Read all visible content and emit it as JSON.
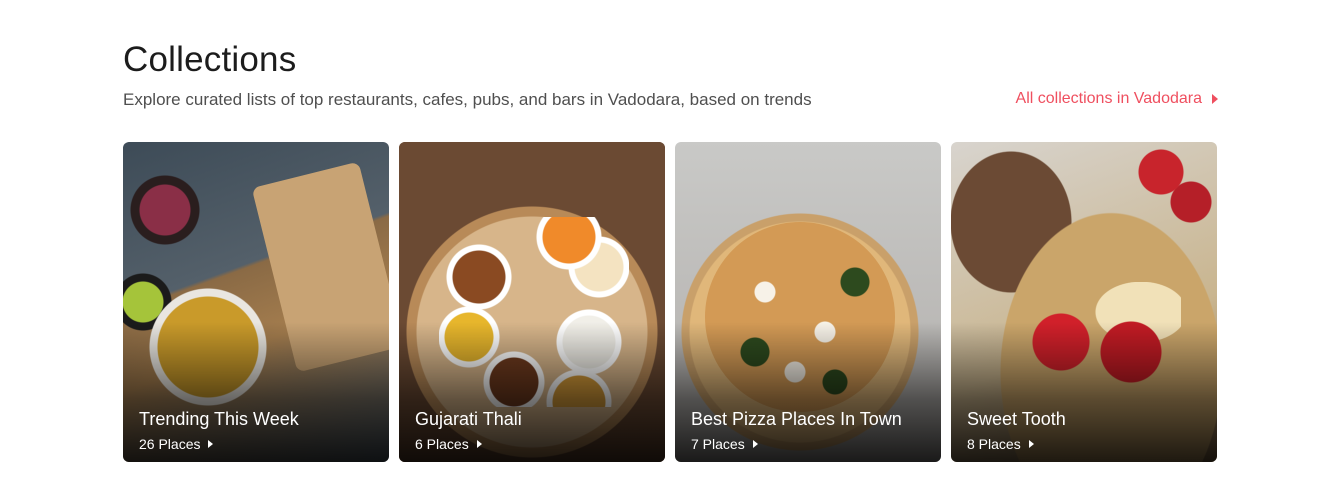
{
  "header": {
    "title": "Collections",
    "subtitle": "Explore curated lists of top restaurants, cafes, pubs, and bars in Vadodara, based on trends",
    "all_link": "All collections in Vadodara"
  },
  "colors": {
    "accent": "#ef4f5f",
    "title": "#1c1c1c",
    "subtitle": "#4f4f4f"
  },
  "collections": [
    {
      "name": "Trending This Week",
      "places": "26 Places"
    },
    {
      "name": "Gujarati Thali",
      "places": "6 Places"
    },
    {
      "name": "Best Pizza Places In Town",
      "places": "7 Places"
    },
    {
      "name": "Sweet Tooth",
      "places": "8 Places"
    }
  ]
}
